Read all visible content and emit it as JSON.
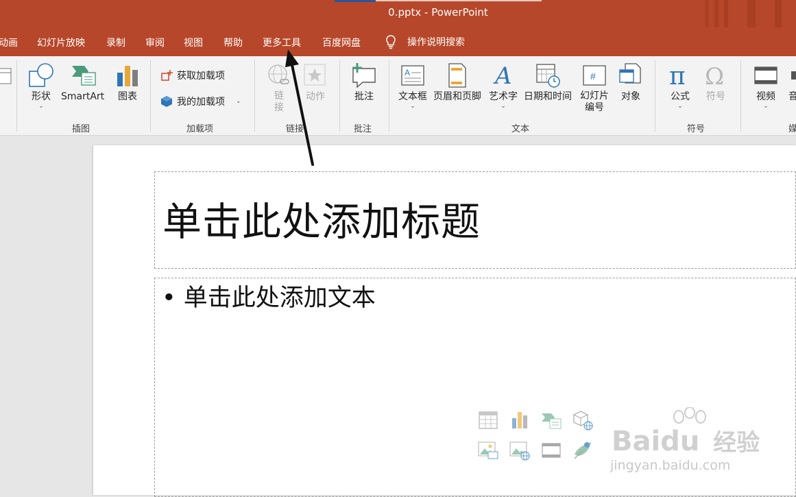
{
  "window": {
    "title": "0.pptx  -  PowerPoint"
  },
  "menu": {
    "tabs": [
      "动画",
      "幻灯片放映",
      "录制",
      "审阅",
      "视图",
      "帮助",
      "更多工具",
      "百度网盘"
    ],
    "search_label": "操作说明搜索"
  },
  "ribbon": {
    "partial_left": "",
    "illustrations": {
      "shapes": "形状",
      "smartart": "SmartArt",
      "chart": "图表",
      "group": "插图"
    },
    "addins": {
      "get": "获取加载项",
      "mine": "我的加载项",
      "group": "加载项"
    },
    "links": {
      "link_top": "链",
      "link_bottom": "接",
      "action": "动作",
      "group": "链接"
    },
    "comments": {
      "comment": "批注",
      "group": "批注"
    },
    "text": {
      "textbox": "文本框",
      "header_footer": "页眉和页脚",
      "wordart": "艺术字",
      "datetime": "日期和时间",
      "slide_num_1": "幻灯片",
      "slide_num_2": "编号",
      "object": "对象",
      "group": "文本"
    },
    "symbols": {
      "equation": "公式",
      "symbol": "符号",
      "group": "符号"
    },
    "media": {
      "video": "视频",
      "audio_partial": "音",
      "group_partial": "媒"
    }
  },
  "slide": {
    "title_placeholder": "单击此处添加标题",
    "body_placeholder": "• 单击此处添加文本"
  },
  "watermark": {
    "brand": "Bai",
    "brand2": "du",
    "cn": "经验",
    "url": "jingyan.baidu.com"
  },
  "colors": {
    "accent": "#b7472a",
    "ribbon_bg": "#f3f3f3"
  }
}
